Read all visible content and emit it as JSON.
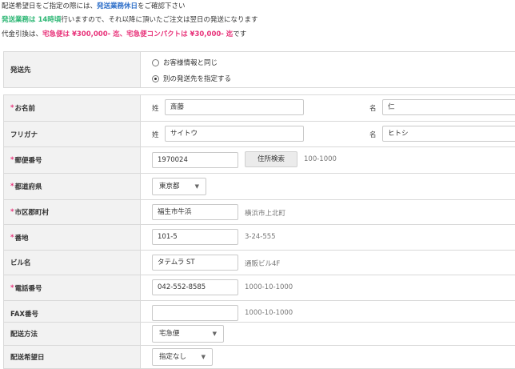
{
  "notices": {
    "line1_a": "配送希望日をご指定の際には、",
    "line1_b": "発送業務休日",
    "line1_c": "をご確認下さい",
    "line2_a": "発送業務は 14時頃",
    "line2_b": "行いますので、それ以降に頂いたご注文は翌日の発送になります",
    "line3_a": "代金引換は、",
    "line3_b": "宅急便は ¥300,000- 迄、宅急便コンパクトは ¥30,000- 迄",
    "line3_c": "です"
  },
  "shipping_dest": {
    "label": "発送先",
    "option_same": "お客様情報と同じ",
    "option_other": "別の発送先を指定する",
    "selected": "option_other"
  },
  "form": {
    "required_mark": "*",
    "name": {
      "label": "お名前",
      "last_label": "姓",
      "last_value": "斎藤",
      "first_label": "名",
      "first_value": "仁"
    },
    "kana": {
      "label": "フリガナ",
      "last_label": "姓",
      "last_value": "サイトウ",
      "first_label": "名",
      "first_value": "ヒトシ"
    },
    "postal": {
      "label": "郵便番号",
      "value": "1970024",
      "button": "住所検索",
      "hint": "100-1000"
    },
    "prefecture": {
      "label": "都道府県",
      "value": "東京都"
    },
    "city": {
      "label": "市区郡町村",
      "value": "福生市牛浜",
      "hint": "横浜市上北町"
    },
    "street": {
      "label": "番地",
      "value": "101-5",
      "hint": "3-24-555"
    },
    "building": {
      "label": "ビル名",
      "value": "タテムラ ST",
      "hint": "通販ビル4F"
    },
    "phone": {
      "label": "電話番号",
      "value": "042-552-8585",
      "hint": "1000-10-1000"
    },
    "fax": {
      "label": "FAX番号",
      "value": "",
      "hint": "1000-10-1000"
    }
  },
  "delivery": {
    "method": {
      "label": "配送方法",
      "value": "宅急便"
    },
    "date": {
      "label": "配送希望日",
      "value": "指定なし"
    }
  },
  "icons": {
    "dropdown": "chevron-down-icon",
    "radio": "radio-icon"
  },
  "colors": {
    "accent_pink": "#e8337a",
    "accent_blue": "#2e6fc9",
    "accent_green": "#2bb673",
    "label_bg": "#f2f2f2"
  }
}
